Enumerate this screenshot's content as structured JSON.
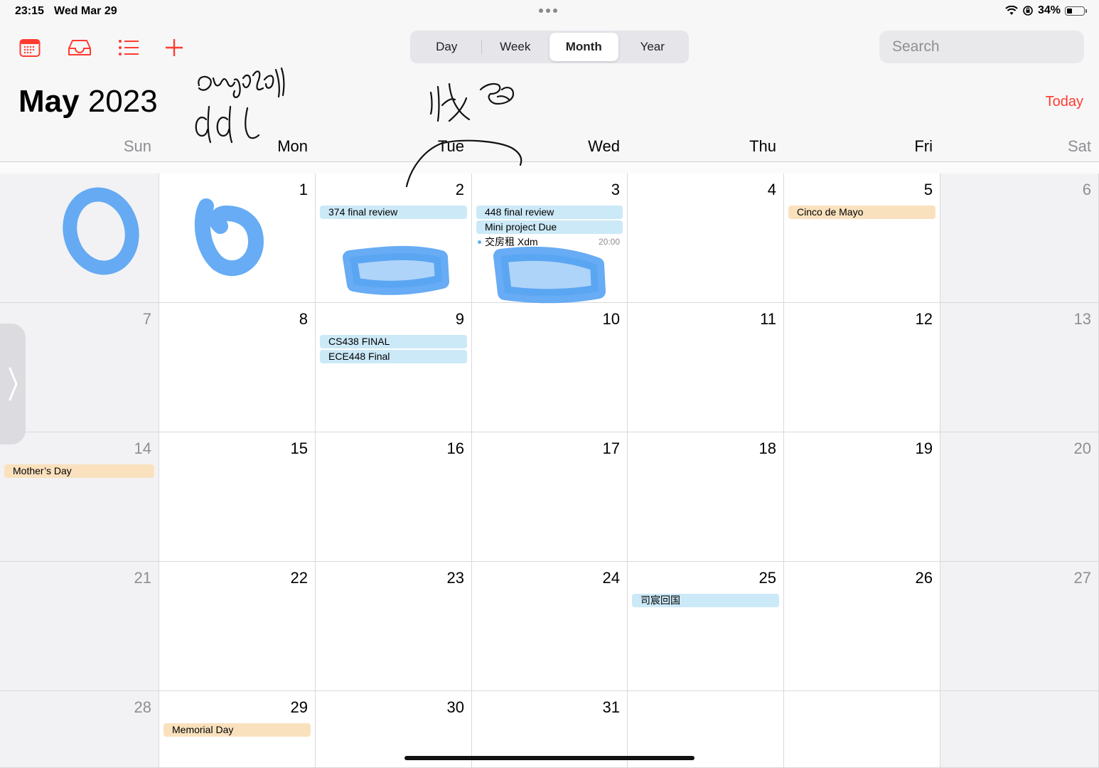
{
  "status_bar": {
    "time": "23:15",
    "date": "Wed Mar 29",
    "battery": "34%",
    "battery_level": 0.34
  },
  "toolbar": {
    "icons": [
      "calendar-icon",
      "inbox-icon",
      "list-icon",
      "plus-icon"
    ],
    "accent_color": "#ff3b30"
  },
  "view_switcher": {
    "options": [
      "Day",
      "Week",
      "Month",
      "Year"
    ],
    "selected": "Month"
  },
  "search": {
    "placeholder": "Search",
    "value": ""
  },
  "header": {
    "month": "May",
    "year": "2023",
    "today_label": "Today"
  },
  "weekdays": [
    "Sun",
    "Mon",
    "Tue",
    "Wed",
    "Thu",
    "Fri",
    "Sat"
  ],
  "weeks": [
    [
      {
        "day": "",
        "events": []
      },
      {
        "day": "1",
        "events": []
      },
      {
        "day": "2",
        "events": [
          {
            "title": "374 final review",
            "color": "blue"
          }
        ]
      },
      {
        "day": "3",
        "events": [
          {
            "title": "448 final review",
            "color": "blue"
          },
          {
            "title": "Mini project Due",
            "color": "blue"
          },
          {
            "title": "交房租 Xdm",
            "time": "20:00",
            "style": "dot"
          }
        ]
      },
      {
        "day": "4",
        "events": []
      },
      {
        "day": "5",
        "events": [
          {
            "title": "Cinco de Mayo",
            "color": "orange"
          }
        ]
      },
      {
        "day": "6",
        "events": []
      }
    ],
    [
      {
        "day": "7",
        "events": []
      },
      {
        "day": "8",
        "events": []
      },
      {
        "day": "9",
        "events": [
          {
            "title": "CS438 FINAL",
            "color": "blue"
          },
          {
            "title": "ECE448 Final",
            "color": "blue"
          }
        ]
      },
      {
        "day": "10",
        "events": []
      },
      {
        "day": "11",
        "events": []
      },
      {
        "day": "12",
        "events": []
      },
      {
        "day": "13",
        "events": []
      }
    ],
    [
      {
        "day": "14",
        "events": [
          {
            "title": "Mother’s Day",
            "color": "orange"
          }
        ]
      },
      {
        "day": "15",
        "events": []
      },
      {
        "day": "16",
        "events": []
      },
      {
        "day": "17",
        "events": []
      },
      {
        "day": "18",
        "events": []
      },
      {
        "day": "19",
        "events": []
      },
      {
        "day": "20",
        "events": []
      }
    ],
    [
      {
        "day": "21",
        "events": []
      },
      {
        "day": "22",
        "events": []
      },
      {
        "day": "23",
        "events": []
      },
      {
        "day": "24",
        "events": []
      },
      {
        "day": "25",
        "events": [
          {
            "title": "司宸回国",
            "color": "blue"
          }
        ]
      },
      {
        "day": "26",
        "events": []
      },
      {
        "day": "27",
        "events": []
      }
    ],
    [
      {
        "day": "28",
        "events": []
      },
      {
        "day": "29",
        "events": [
          {
            "title": "Memorial Day",
            "color": "orange"
          }
        ]
      },
      {
        "day": "30",
        "events": []
      },
      {
        "day": "31",
        "events": []
      },
      {
        "day": "",
        "events": []
      },
      {
        "day": "",
        "events": []
      },
      {
        "day": "",
        "events": []
      }
    ]
  ]
}
